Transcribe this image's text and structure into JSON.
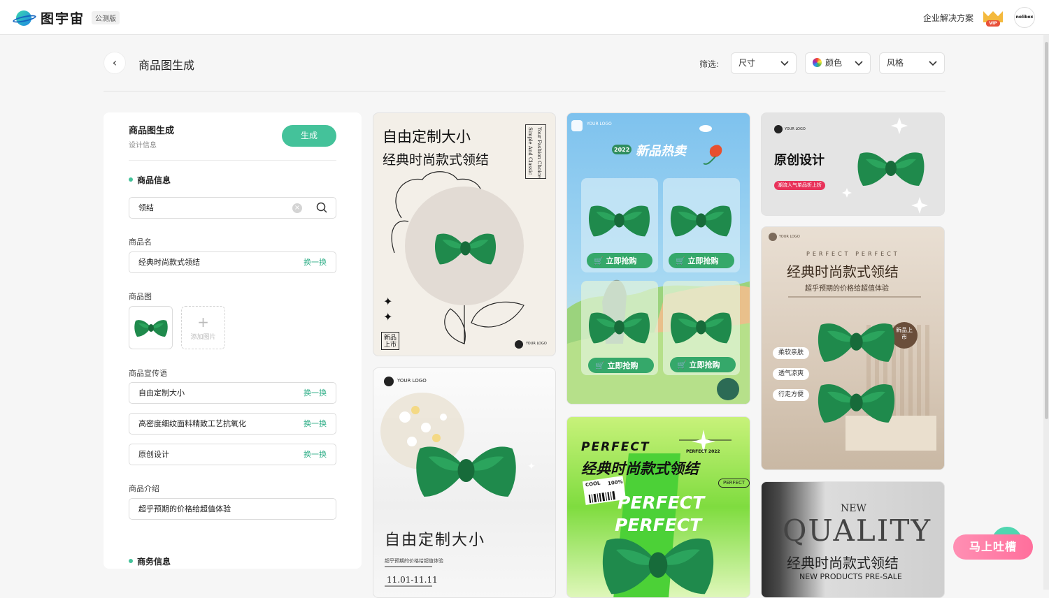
{
  "header": {
    "app_name": "图宇宙",
    "beta_tag": "公测版",
    "enterprise_link": "企业解决方案",
    "vip_badge": "VIP",
    "avatar_label": "nolibox"
  },
  "page": {
    "title": "商品图生成",
    "filter_label": "筛选:",
    "filters": [
      {
        "label": "尺寸"
      },
      {
        "label": "颜色"
      },
      {
        "label": "风格"
      }
    ]
  },
  "panel": {
    "title": "商品图生成",
    "subtitle": "设计信息",
    "generate_button": "生成",
    "product_info": {
      "heading": "商品信息",
      "search_value": "领结",
      "name_label": "商品名",
      "name_value": "经典时尚款式领结",
      "image_label": "商品图",
      "add_image_label": "添加图片",
      "slogan_label": "商品宣传语",
      "slogans": [
        "自由定制大小",
        "高密度细纹面料精致工艺抗氧化",
        "原创设计"
      ],
      "intro_label": "商品介绍",
      "intro_value": "超乎预期的价格给超值体验",
      "swap_label": "换一换"
    },
    "business_info": {
      "heading": "商务信息"
    }
  },
  "cards": {
    "c1": {
      "title1": "自由定制大小",
      "title2": "经典时尚款式领结",
      "side_text1": "Your Fashion Choice",
      "side_text2": "Simple And Classic",
      "badge": "新品上市",
      "logo": "YOUR LOGO"
    },
    "c2": {
      "logo": "YOUR LOGO",
      "year": "2022",
      "title": "新品热卖",
      "cta": "立即抢购"
    },
    "c3": {
      "logo": "YOUR LOGO",
      "title": "原创设计",
      "tag": "潮流人气单品折上折"
    },
    "c4": {
      "logo": "YOUR LOGO",
      "subtitle": "PERFECT PERFECT",
      "title": "经典时尚款式领结",
      "tagline": "超乎预期的价格给超值体验",
      "badge": "新品上市",
      "features": [
        "柔软亲肤",
        "透气凉爽",
        "行走方便"
      ]
    },
    "c5": {
      "logo": "YOUR LOGO",
      "title": "自由定制大小",
      "tagline": "超乎预期的价格给超值体验",
      "date": "11.01-11.11"
    },
    "c6": {
      "brand": "PERFECT",
      "year_tag": "PERFECT 2022",
      "title": "经典时尚款式领结",
      "pill": "PERFECT",
      "cool": "COOL",
      "percent": "100%",
      "big_word": "PERFECT"
    },
    "c7": {
      "new": "NEW",
      "quality": "QUALITY",
      "title": "经典时尚款式领结",
      "subtitle": "NEW PRODUCTS PRE-SALE"
    }
  },
  "float_button": {
    "label": "马上吐槽"
  },
  "colors": {
    "accent": "#44c29a",
    "bow_green": "#1f8a4c"
  }
}
